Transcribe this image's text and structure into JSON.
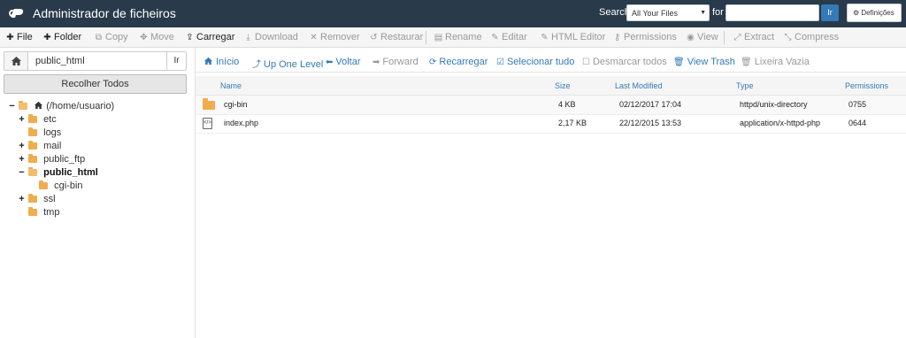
{
  "topbar": {
    "title": "Administrador de ficheiros",
    "search_label": "Search",
    "search_scope": "All Your Files",
    "for_label": "for",
    "search_value": "",
    "go_label": "Ir",
    "settings_label": "Definições",
    "colors": {
      "bar": "#293a4a",
      "accent": "#337ab7"
    }
  },
  "toolbar": [
    {
      "label": "File",
      "icon": "plus-icon",
      "enabled": true
    },
    {
      "label": "Folder",
      "icon": "plus-icon",
      "enabled": true
    },
    {
      "label": "Copy",
      "icon": "copy-icon",
      "enabled": false
    },
    {
      "label": "Move",
      "icon": "move-icon",
      "enabled": false
    },
    {
      "label": "Carregar",
      "icon": "upload-icon",
      "enabled": true
    },
    {
      "label": "Download",
      "icon": "download-icon",
      "enabled": false
    },
    {
      "label": "Remover",
      "icon": "remove-icon",
      "enabled": false
    },
    {
      "label": "Restaurar",
      "icon": "restore-icon",
      "enabled": false
    },
    {
      "label": "Rename",
      "icon": "rename-icon",
      "enabled": false
    },
    {
      "label": "Editar",
      "icon": "edit-icon",
      "enabled": false
    },
    {
      "label": "HTML Editor",
      "icon": "html-editor-icon",
      "enabled": false
    },
    {
      "label": "Permissions",
      "icon": "key-icon",
      "enabled": false
    },
    {
      "label": "View",
      "icon": "eye-icon",
      "enabled": false
    },
    {
      "label": "Extract",
      "icon": "expand-icon",
      "enabled": false
    },
    {
      "label": "Compress",
      "icon": "compress-icon",
      "enabled": false
    }
  ],
  "sidebar": {
    "path_value": "public_html",
    "go_label": "Ir",
    "collapse_label": "Recolher Todos",
    "tree": [
      {
        "label": "(/home/usuario)",
        "toggle": "−",
        "icon": "home-icon",
        "expanded": true
      },
      {
        "label": "etc",
        "toggle": "+",
        "icon": "folder-icon"
      },
      {
        "label": "logs",
        "toggle": "",
        "icon": "folder-icon"
      },
      {
        "label": "mail",
        "toggle": "+",
        "icon": "folder-icon"
      },
      {
        "label": "public_ftp",
        "toggle": "+",
        "icon": "folder-icon"
      },
      {
        "label": "public_html",
        "toggle": "−",
        "icon": "folder-open-icon",
        "current": true
      },
      {
        "label": "cgi-bin",
        "toggle": "",
        "icon": "folder-icon"
      },
      {
        "label": "ssl",
        "toggle": "+",
        "icon": "folder-icon"
      },
      {
        "label": "tmp",
        "toggle": "",
        "icon": "folder-icon"
      }
    ]
  },
  "navbar": [
    {
      "label": "Início",
      "icon": "home-icon",
      "enabled": true
    },
    {
      "label": "Up One Level",
      "icon": "level-up-icon",
      "enabled": true
    },
    {
      "label": "Voltar",
      "icon": "arrow-left-icon",
      "enabled": true
    },
    {
      "label": "Forward",
      "icon": "arrow-right-icon",
      "enabled": false
    },
    {
      "label": "Recarregar",
      "icon": "refresh-icon",
      "enabled": true
    },
    {
      "label": "Selecionar tudo",
      "icon": "checkbox-checked-icon",
      "enabled": true
    },
    {
      "label": "Desmarcar todos",
      "icon": "checkbox-empty-icon",
      "enabled": false
    },
    {
      "label": "View Trash",
      "icon": "trash-icon",
      "enabled": true
    },
    {
      "label": "Lixeira Vazia",
      "icon": "trash-icon",
      "enabled": false
    }
  ],
  "table": {
    "columns": [
      "Name",
      "Size",
      "Last Modified",
      "Type",
      "Permissions"
    ],
    "rows": [
      {
        "icon": "folder-icon",
        "name": "cgi-bin",
        "size": "4 KB",
        "modified": "02/12/2017 17:04",
        "type": "httpd/unix-directory",
        "perms": "0755"
      },
      {
        "icon": "php-file-icon",
        "name": "index.php",
        "size": "2,17 KB",
        "modified": "22/12/2015 13:53",
        "type": "application/x-httpd-php",
        "perms": "0644"
      }
    ]
  }
}
